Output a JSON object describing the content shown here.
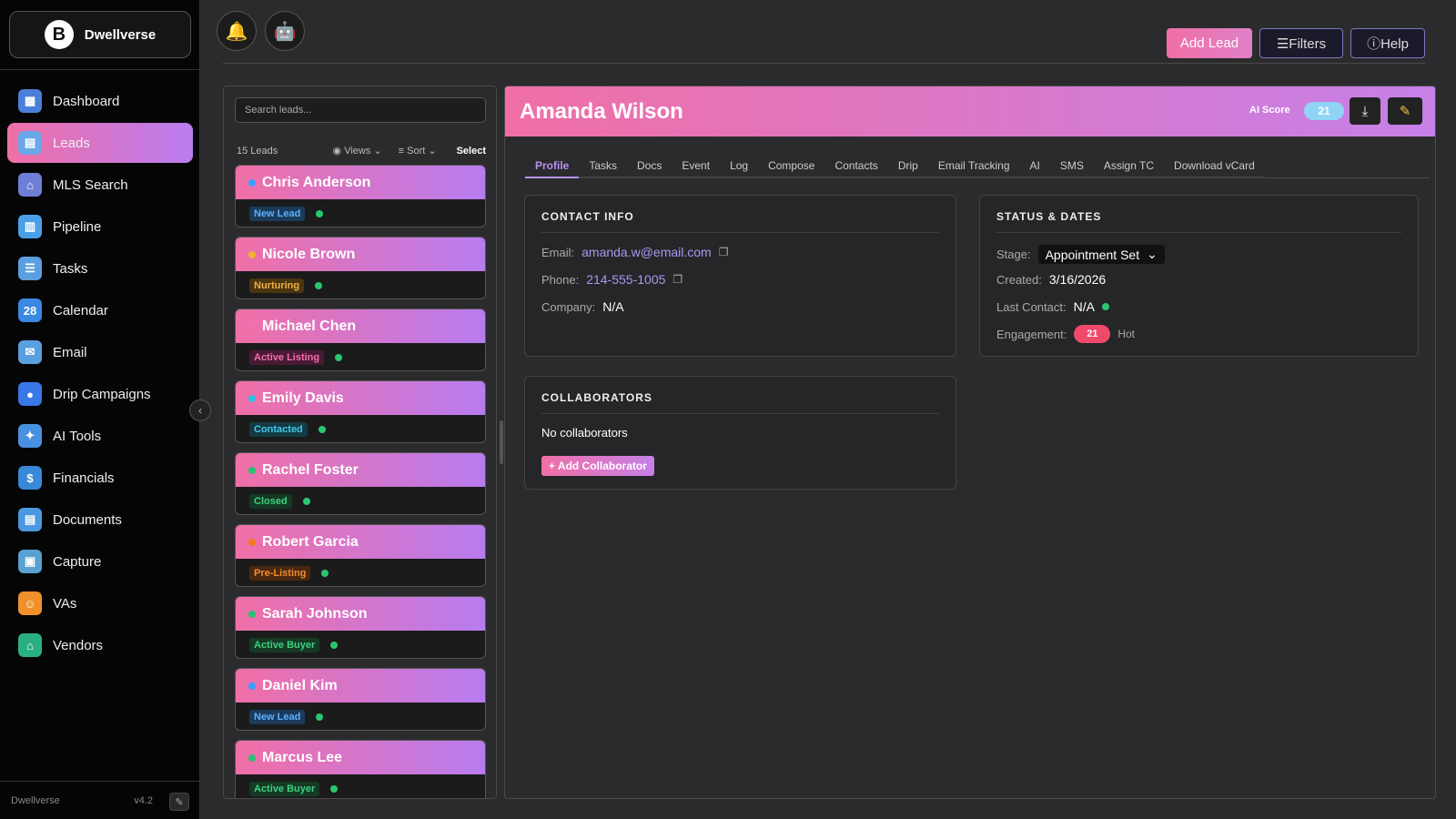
{
  "brand": {
    "logo_letter": "B",
    "name": "Dwellverse"
  },
  "sidebar": {
    "items": [
      {
        "label": "Dashboard",
        "icon": "chart-icon",
        "icon_color": "#4a7fd8",
        "glyph": "▦"
      },
      {
        "label": "Leads",
        "icon": "id-card-icon",
        "icon_color": "#6aa8e8",
        "glyph": "▤",
        "active": true
      },
      {
        "label": "MLS Search",
        "icon": "house-icon",
        "icon_color": "#6f7fd8",
        "glyph": "⌂"
      },
      {
        "label": "Pipeline",
        "icon": "bar-chart-icon",
        "icon_color": "#4aa0e8",
        "glyph": "▥"
      },
      {
        "label": "Tasks",
        "icon": "checklist-icon",
        "icon_color": "#5a9fe0",
        "glyph": "☰"
      },
      {
        "label": "Calendar",
        "icon": "calendar-icon",
        "icon_color": "#3a88e0",
        "glyph": "28"
      },
      {
        "label": "Email",
        "icon": "email-icon",
        "icon_color": "#5a9fe0",
        "glyph": "✉"
      },
      {
        "label": "Drip Campaigns",
        "icon": "droplet-icon",
        "icon_color": "#3a78e8",
        "glyph": "●"
      },
      {
        "label": "AI Tools",
        "icon": "ai-tools-icon",
        "icon_color": "#4a90e0",
        "glyph": "✦"
      },
      {
        "label": "Financials",
        "icon": "money-icon",
        "icon_color": "#3a88d8",
        "glyph": "$"
      },
      {
        "label": "Documents",
        "icon": "document-icon",
        "icon_color": "#4a98e0",
        "glyph": "▤"
      },
      {
        "label": "Capture",
        "icon": "clipboard-icon",
        "icon_color": "#5aa0d0",
        "glyph": "▣"
      },
      {
        "label": "VAs",
        "icon": "assistant-icon",
        "icon_color": "#f0902a",
        "glyph": "☺"
      },
      {
        "label": "Vendors",
        "icon": "shop-icon",
        "icon_color": "#2ab080",
        "glyph": "⌂"
      }
    ],
    "footer_name": "Dwellverse",
    "version": "v4.2"
  },
  "top": {
    "bell_icon": "🔔",
    "bot_icon": "🤖",
    "add_lead": "Add Lead",
    "filters": "☰Filters",
    "help": "ⓘHelp"
  },
  "leads": {
    "search_placeholder": "Search leads...",
    "count": "15 Leads",
    "views": "Views",
    "sort": "Sort",
    "select": "Select",
    "items": [
      {
        "name": "Chris Anderson",
        "dot": "#3aa0ff",
        "tag": "New Lead",
        "tag_bg": "#1c3a5a",
        "tag_fg": "#5ab0ff"
      },
      {
        "name": "Nicole Brown",
        "dot": "#f0b030",
        "tag": "Nurturing",
        "tag_bg": "#4a3510",
        "tag_fg": "#f0b040"
      },
      {
        "name": "Michael Chen",
        "dot": "#f070b0",
        "tag": "Active Listing",
        "tag_bg": "#4a1a35",
        "tag_fg": "#f070b0"
      },
      {
        "name": "Emily Davis",
        "dot": "#30c0e0",
        "tag": "Contacted",
        "tag_bg": "#143a45",
        "tag_fg": "#40c8e8"
      },
      {
        "name": "Rachel Foster",
        "dot": "#2ac070",
        "tag": "Closed",
        "tag_bg": "#143a24",
        "tag_fg": "#40d080"
      },
      {
        "name": "Robert Garcia",
        "dot": "#f07a20",
        "tag": "Pre-Listing",
        "tag_bg": "#4a2810",
        "tag_fg": "#f08a30"
      },
      {
        "name": "Sarah Johnson",
        "dot": "#2ac070",
        "tag": "Active Buyer",
        "tag_bg": "#143a24",
        "tag_fg": "#40d080"
      },
      {
        "name": "Daniel Kim",
        "dot": "#3aa0ff",
        "tag": "New Lead",
        "tag_bg": "#1c3a5a",
        "tag_fg": "#5ab0ff"
      },
      {
        "name": "Marcus Lee",
        "dot": "#2ac070",
        "tag": "Active Buyer",
        "tag_bg": "#143a24",
        "tag_fg": "#40d080"
      }
    ]
  },
  "detail": {
    "name": "Amanda Wilson",
    "ai_score_label": "AI Score",
    "ai_score": "21",
    "tabs": [
      "Profile",
      "Tasks",
      "Docs",
      "Event",
      "Log",
      "Compose",
      "Contacts",
      "Drip",
      "Email Tracking",
      "AI",
      "SMS",
      "Assign TC",
      "Download vCard"
    ],
    "contact": {
      "title": "CONTACT INFO",
      "email_label": "Email:",
      "email": "amanda.w@email.com",
      "phone_label": "Phone:",
      "phone": "214-555-1005",
      "company_label": "Company:",
      "company": "N/A"
    },
    "status": {
      "title": "STATUS & DATES",
      "stage_label": "Stage:",
      "stage": "Appointment Set",
      "created_label": "Created:",
      "created": "3/16/2026",
      "last_label": "Last Contact:",
      "last": "N/A",
      "eng_label": "Engagement:",
      "eng": "21",
      "eng_text": "Hot"
    },
    "collab": {
      "title": "COLLABORATORS",
      "empty": "No collaborators",
      "add": "+ Add Collaborator"
    }
  }
}
